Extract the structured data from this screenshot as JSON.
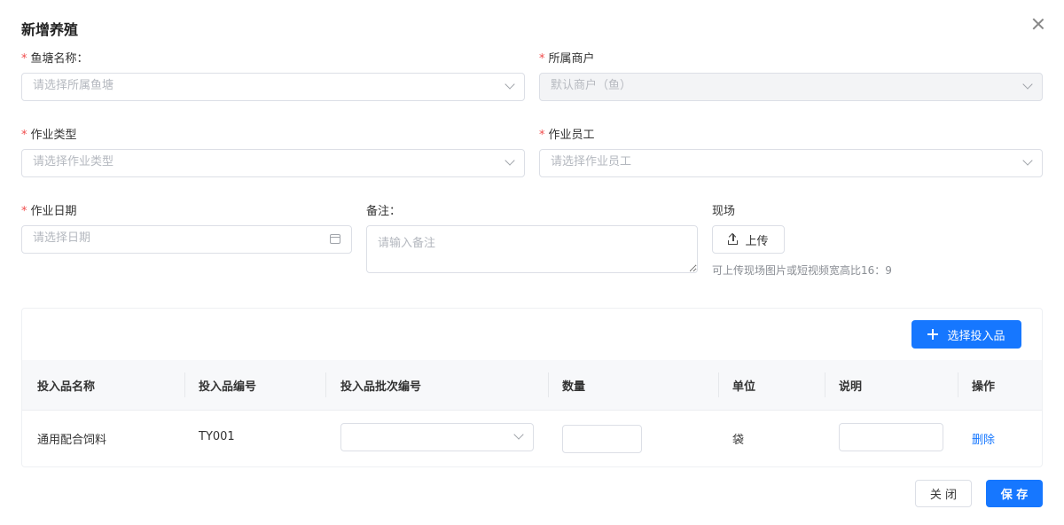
{
  "dialog": {
    "title": "新增养殖"
  },
  "form": {
    "pond": {
      "label": "鱼塘名称：",
      "placeholder": "请选择所属鱼塘"
    },
    "merchant": {
      "label": "所属商户",
      "value": "默认商户（鱼）"
    },
    "work_type": {
      "label": "作业类型",
      "placeholder": "请选择作业类型"
    },
    "staff": {
      "label": "作业员工",
      "placeholder": "请选择作业员工"
    },
    "date": {
      "label": "作业日期",
      "placeholder": "请选择日期"
    },
    "remark": {
      "label": "备注：",
      "placeholder": "请输入备注"
    },
    "site": {
      "label": "现场",
      "upload_label": "上传",
      "hint": "可上传现场图片或短视频宽高比16：9"
    }
  },
  "inputs_panel": {
    "select_button": "选择投入品",
    "columns": [
      "投入品名称",
      "投入品编号",
      "投入品批次编号",
      "数量",
      "单位",
      "说明",
      "操作"
    ],
    "rows": [
      {
        "name": "通用配合饲料",
        "code": "TY001",
        "batch": "",
        "quantity": "",
        "unit": "袋",
        "note": "",
        "action": "删除"
      }
    ]
  },
  "footer": {
    "close_label": "关 闭",
    "save_label": "保 存"
  },
  "colors": {
    "primary": "#1677ff",
    "required": "#f04b4b"
  }
}
